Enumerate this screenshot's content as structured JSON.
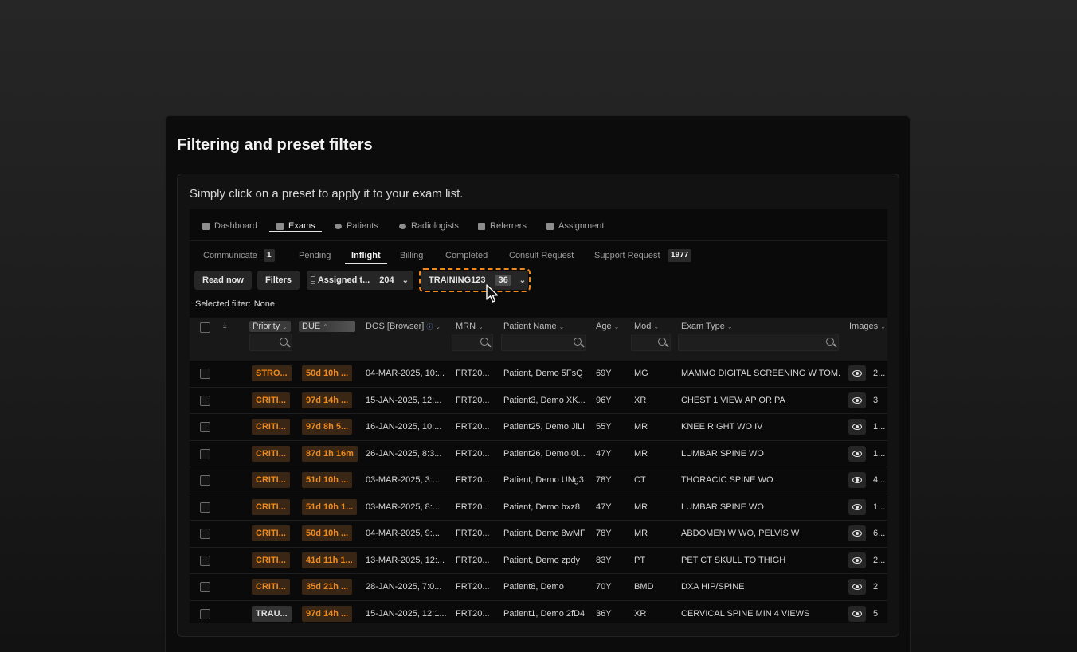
{
  "card": {
    "title": "Filtering and preset filters",
    "hint": "Simply click on a preset to apply it to your exam list."
  },
  "topnav": [
    {
      "label": "Dashboard",
      "icon": "dashboard-icon"
    },
    {
      "label": "Exams",
      "icon": "exams-icon",
      "active": true
    },
    {
      "label": "Patients",
      "icon": "patients-icon"
    },
    {
      "label": "Radiologists",
      "icon": "radiologists-icon"
    },
    {
      "label": "Referrers",
      "icon": "referrers-icon"
    },
    {
      "label": "Assignment",
      "icon": "assignment-icon"
    }
  ],
  "subtabs": [
    {
      "label": "Communicate",
      "count": "1"
    },
    {
      "label": "Pending"
    },
    {
      "label": "Inflight",
      "active": true
    },
    {
      "label": "Billing"
    },
    {
      "label": "Completed"
    },
    {
      "label": "Consult Request"
    },
    {
      "label": "Support Request",
      "count": "1977"
    }
  ],
  "toolbar": {
    "read_now": "Read now",
    "filters": "Filters",
    "preset1": {
      "label": "Assigned t...",
      "count": "204"
    },
    "preset2": {
      "label": "TRAINING123",
      "count": "36"
    }
  },
  "selected_filter": {
    "label": "Selected filter:",
    "value": "None"
  },
  "columns": {
    "priority": "Priority",
    "due": "DUE",
    "dos": "DOS [Browser]",
    "mrn": "MRN",
    "patient": "Patient Name",
    "age": "Age",
    "mod": "Mod",
    "exam_type": "Exam Type",
    "images": "Images"
  },
  "rows": [
    {
      "priority": "STRO...",
      "due": "50d 10h ...",
      "dos": "04-MAR-2025, 10:...",
      "mrn": "FRT20...",
      "patient": "Patient, Demo 5FsQ",
      "age": "69Y",
      "mod": "MG",
      "exam": "MAMMO DIGITAL SCREENING W TOM...",
      "images": "2..."
    },
    {
      "priority": "CRITI...",
      "due": "97d 14h ...",
      "dos": "15-JAN-2025, 12:...",
      "mrn": "FRT20...",
      "patient": "Patient3, Demo XK...",
      "age": "96Y",
      "mod": "XR",
      "exam": "CHEST 1 VIEW AP OR PA",
      "images": "3"
    },
    {
      "priority": "CRITI...",
      "due": "97d 8h 5...",
      "dos": "16-JAN-2025, 10:...",
      "mrn": "FRT20...",
      "patient": "Patient25, Demo JiLI",
      "age": "55Y",
      "mod": "MR",
      "exam": "KNEE RIGHT WO IV",
      "images": "1..."
    },
    {
      "priority": "CRITI...",
      "due": "87d 1h 16m",
      "dos": "26-JAN-2025, 8:3...",
      "mrn": "FRT20...",
      "patient": "Patient26, Demo 0l...",
      "age": "47Y",
      "mod": "MR",
      "exam": "LUMBAR SPINE WO",
      "images": "1..."
    },
    {
      "priority": "CRITI...",
      "due": "51d 10h ...",
      "dos": "03-MAR-2025, 3:...",
      "mrn": "FRT20...",
      "patient": "Patient, Demo UNg3",
      "age": "78Y",
      "mod": "CT",
      "exam": "THORACIC SPINE WO",
      "images": "4..."
    },
    {
      "priority": "CRITI...",
      "due": "51d 10h 1...",
      "dos": "03-MAR-2025, 8:...",
      "mrn": "FRT20...",
      "patient": "Patient, Demo bxz8",
      "age": "47Y",
      "mod": "MR",
      "exam": "LUMBAR SPINE WO",
      "images": "1..."
    },
    {
      "priority": "CRITI...",
      "due": "50d 10h ...",
      "dos": "04-MAR-2025, 9:...",
      "mrn": "FRT20...",
      "patient": "Patient, Demo 8wMF",
      "age": "78Y",
      "mod": "MR",
      "exam": "ABDOMEN W WO, PELVIS W",
      "images": "6..."
    },
    {
      "priority": "CRITI...",
      "due": "41d 11h 1...",
      "dos": "13-MAR-2025, 12:...",
      "mrn": "FRT20...",
      "patient": "Patient, Demo zpdy",
      "age": "83Y",
      "mod": "PT",
      "exam": "PET CT SKULL TO THIGH",
      "images": "2..."
    },
    {
      "priority": "CRITI...",
      "due": "35d 21h ...",
      "dos": "28-JAN-2025, 7:0...",
      "mrn": "FRT20...",
      "patient": "Patient8, Demo",
      "age": "70Y",
      "mod": "BMD",
      "exam": "DXA HIP/SPINE",
      "images": "2"
    },
    {
      "priority": "TRAU...",
      "due": "97d 14h ...",
      "dos": "15-JAN-2025, 12:1...",
      "mrn": "FRT20...",
      "patient": "Patient1, Demo 2fD4",
      "age": "36Y",
      "mod": "XR",
      "exam": "CERVICAL SPINE MIN 4 VIEWS",
      "images": "5"
    }
  ]
}
